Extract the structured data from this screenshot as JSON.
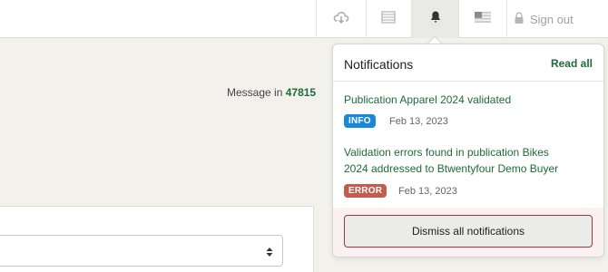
{
  "header": {
    "buttons": [
      {
        "icon": "cloud-download-icon"
      },
      {
        "icon": "list-icon"
      },
      {
        "icon": "bell-icon"
      },
      {
        "icon": "us-flag-icon"
      }
    ],
    "sign_out": {
      "icon": "lock-icon",
      "label": "Sign out"
    }
  },
  "main": {
    "message_prefix": "Message in",
    "message_number": "47815"
  },
  "notifications": {
    "title": "Notifications",
    "read_all": "Read all",
    "items": [
      {
        "title": "Publication Apparel 2024 validated",
        "badge": "INFO",
        "date": "Feb 13, 2023"
      },
      {
        "title_lines": [
          "Validation errors found in publication Bikes",
          "2024 addressed to Btwentyfour Demo Buyer"
        ],
        "badge": "ERROR",
        "date": "Feb 13, 2023"
      }
    ],
    "dismiss_all": "Dismiss all notifications"
  },
  "colors": {
    "accent_green": "#1f6b3a",
    "info_blue": "#1a88d8",
    "error_red": "#c55a4f",
    "dismiss_border": "#a6353f"
  }
}
